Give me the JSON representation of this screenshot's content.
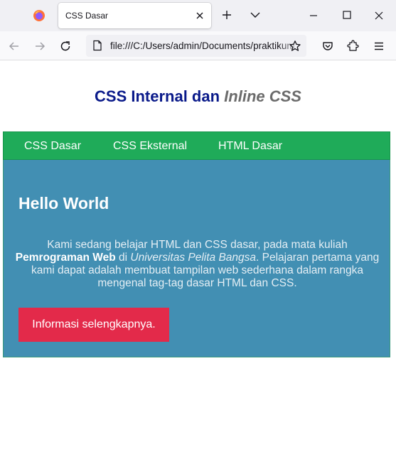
{
  "browser": {
    "tab_title": "CSS Dasar",
    "url": "file:///C:/Users/admin/Documents/praktikum",
    "colors": {
      "tabstrip": "#f0f0f4",
      "toolbar": "#f9f9fb"
    }
  },
  "page": {
    "title_main": "CSS Internal dan ",
    "title_inline": "Inline CSS",
    "menu": [
      {
        "label": "CSS Dasar"
      },
      {
        "label": "CSS Eksternal"
      },
      {
        "label": "HTML Dasar"
      }
    ],
    "heading": "Hello World",
    "paragraph": {
      "part1": "Kami sedang belajar HTML dan CSS dasar, pada mata kuliah ",
      "bold": "Pemrograman Web",
      "part2": " di ",
      "italic": "Universitas Pelita Bangsa",
      "part3": ". Pelajaran pertama yang kami dapat adalah membuat tampilan web sederhana dalam rangka mengenal tag-tag dasar HTML dan CSS."
    },
    "button_label": "Informasi selengkapnya.",
    "colors": {
      "title": "#0a1a8a",
      "title_inline": "#6b6b6b",
      "menu_bg": "#1fab59",
      "content_bg": "#428fb3",
      "button_bg": "#e32a4a"
    }
  }
}
